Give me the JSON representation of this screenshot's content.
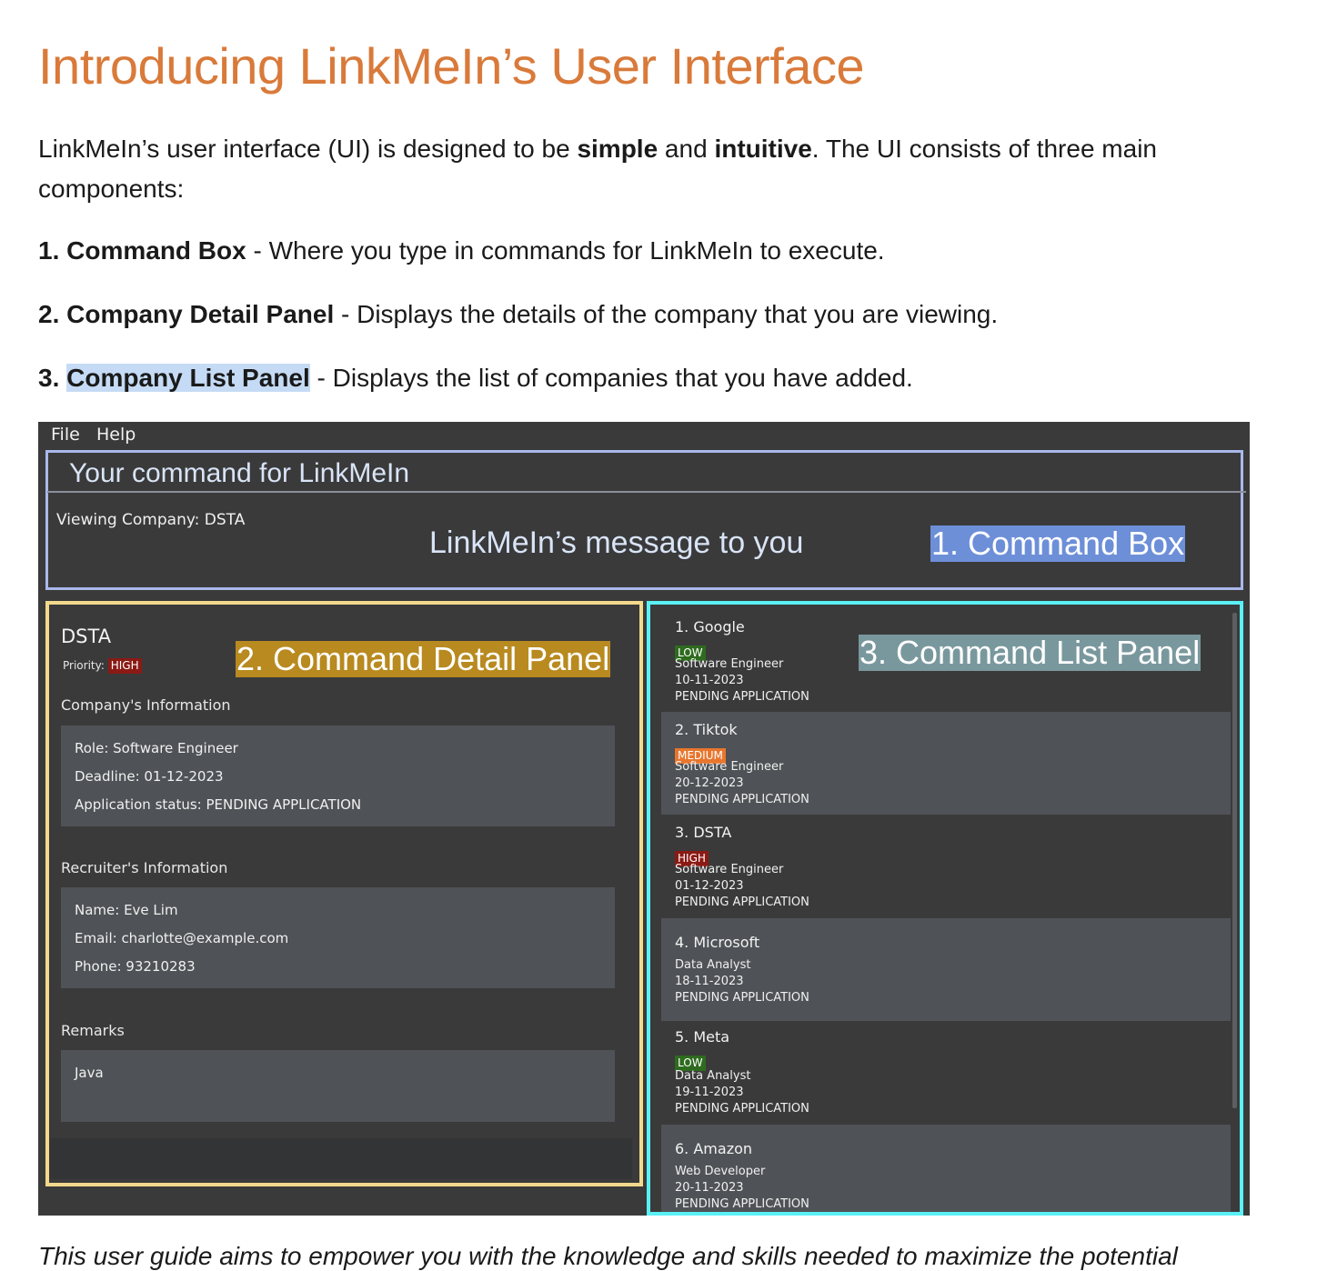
{
  "heading": "Introducing LinkMeIn’s User Interface",
  "intro": {
    "before": "LinkMeIn’s user interface (UI) is designed to be ",
    "simple": "simple",
    "and": " and ",
    "intuitive": "intuitive",
    "after": ". The UI consists of three main components:"
  },
  "components": [
    {
      "title": "1. Command Box",
      "desc": " - Where you type in commands for LinkMeIn to execute."
    },
    {
      "title_num": "2. ",
      "title": "Company Detail Panel",
      "desc": " - Displays the details of the company that you are viewing."
    },
    {
      "title_num": "3. ",
      "title": "Company List Panel",
      "desc": " - Displays the list of companies that you have added."
    }
  ],
  "app": {
    "menu": [
      "File",
      "Help"
    ],
    "command_placeholder": "Your command for LinkMeIn",
    "result_text": "Viewing Company: DSTA",
    "result_overlay": "LinkMeIn’s message to you",
    "callouts": {
      "command_box": "1. Command Box",
      "detail_panel": "2. Command Detail Panel",
      "list_panel": "3. Command List Panel"
    },
    "detail": {
      "name": "DSTA",
      "priority_label": "Priority:",
      "priority": "HIGH",
      "company_info_label": "Company's Information",
      "role": "Role: Software Engineer",
      "deadline": "Deadline: 01-12-2023",
      "status": "Application status: PENDING APPLICATION",
      "recruiter_info_label": "Recruiter's Information",
      "recruiter_name": "Name: Eve Lim",
      "recruiter_email": "Email: charlotte@example.com",
      "recruiter_phone": "Phone: 93210283",
      "remarks_label": "Remarks",
      "remarks": "Java"
    },
    "companies": [
      {
        "name": "1.  Google",
        "priority": "LOW",
        "role": "Software Engineer",
        "date": "10-11-2023",
        "status": "PENDING APPLICATION"
      },
      {
        "name": "2.  Tiktok",
        "priority": "MEDIUM",
        "role": "Software Engineer",
        "date": "20-12-2023",
        "status": "PENDING APPLICATION"
      },
      {
        "name": "3.  DSTA",
        "priority": "HIGH",
        "role": "Software Engineer",
        "date": "01-12-2023",
        "status": "PENDING APPLICATION"
      },
      {
        "name": "4.  Microsoft",
        "priority": "",
        "role": "Data Analyst",
        "date": "18-11-2023",
        "status": "PENDING APPLICATION"
      },
      {
        "name": "5.  Meta",
        "priority": "LOW",
        "role": "Data Analyst",
        "date": "19-11-2023",
        "status": "PENDING APPLICATION"
      },
      {
        "name": "6.  Amazon",
        "priority": "",
        "role": "Web Developer",
        "date": "20-11-2023",
        "status": "PENDING APPLICATION"
      }
    ],
    "priority_colors": {
      "LOW": "#2e6b1f",
      "MEDIUM": "#e8762d",
      "HIGH": "#8b1a14"
    }
  },
  "closing": "This user guide aims to empower you with the knowledge and skills needed to maximize the potential"
}
